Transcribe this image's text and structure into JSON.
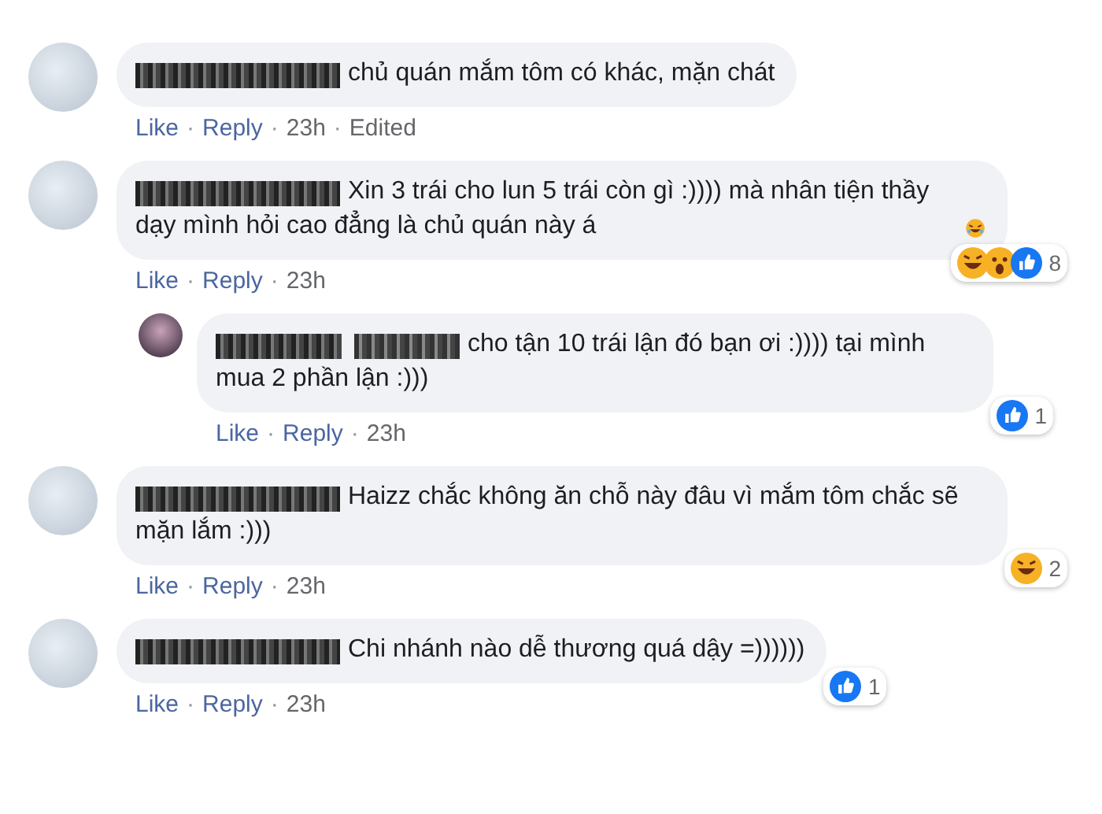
{
  "comments": [
    {
      "text": "chủ quán mắm tôm có khác, mặn chát",
      "actions": [
        {
          "kind": "link",
          "text": "Like"
        },
        {
          "kind": "sep",
          "text": "·"
        },
        {
          "kind": "link",
          "text": "Reply"
        },
        {
          "kind": "sep",
          "text": "·"
        },
        {
          "kind": "time",
          "text": "23h"
        },
        {
          "kind": "sep",
          "text": "·"
        },
        {
          "kind": "note",
          "text": "Edited"
        }
      ]
    },
    {
      "text": "Xin 3 trái cho lun 5 trái còn gì :)))) mà nhân tiện thầy dạy mình hỏi cao đẳng là chủ quán này á",
      "trailing_icon": {
        "kind": "laughing"
      },
      "actions": [
        {
          "kind": "link",
          "text": "Like"
        },
        {
          "kind": "sep",
          "text": "·"
        },
        {
          "kind": "link",
          "text": "Reply"
        },
        {
          "kind": "sep",
          "text": "·"
        },
        {
          "kind": "time",
          "text": "23h"
        }
      ],
      "reactions": {
        "icons": [
          {
            "kind": "haha"
          },
          {
            "kind": "wow"
          },
          {
            "kind": "like"
          }
        ],
        "count": "8"
      },
      "replies": [
        {
          "text": "cho tận 10 trái lận đó bạn ơi :)))) tại mình mua 2 phần lận :)))",
          "actions": [
            {
              "kind": "link",
              "text": "Like"
            },
            {
              "kind": "sep",
              "text": "·"
            },
            {
              "kind": "link",
              "text": "Reply"
            },
            {
              "kind": "sep",
              "text": "·"
            },
            {
              "kind": "time",
              "text": "23h"
            }
          ],
          "reactions": {
            "icons": [
              {
                "kind": "like"
              }
            ],
            "count": "1"
          }
        }
      ]
    },
    {
      "text": "Haizz chắc không ăn chỗ này đâu vì mắm tôm chắc sẽ mặn lắm :)))",
      "actions": [
        {
          "kind": "link",
          "text": "Like"
        },
        {
          "kind": "sep",
          "text": "·"
        },
        {
          "kind": "link",
          "text": "Reply"
        },
        {
          "kind": "sep",
          "text": "·"
        },
        {
          "kind": "time",
          "text": "23h"
        }
      ],
      "reactions": {
        "icons": [
          {
            "kind": "haha"
          }
        ],
        "count": "2"
      }
    },
    {
      "text": "Chi nhánh nào dễ thương quá dậy =))))))",
      "actions": [
        {
          "kind": "link",
          "text": "Like"
        },
        {
          "kind": "sep",
          "text": "·"
        },
        {
          "kind": "link",
          "text": "Reply"
        },
        {
          "kind": "sep",
          "text": "·"
        },
        {
          "kind": "time",
          "text": "23h"
        }
      ],
      "reactions": {
        "icons": [
          {
            "kind": "like"
          }
        ],
        "count": "1"
      }
    }
  ]
}
